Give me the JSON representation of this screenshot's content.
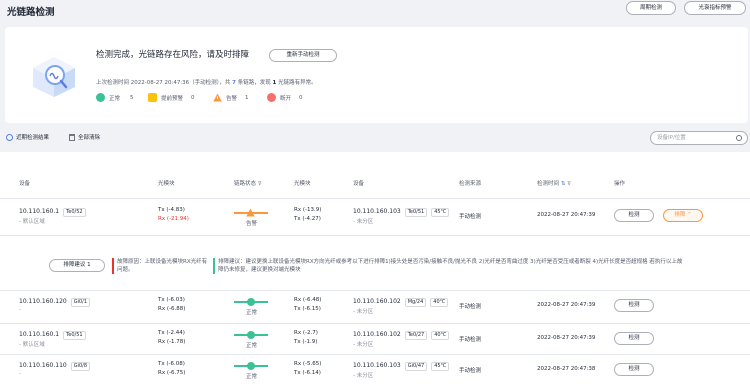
{
  "header": {
    "title": "光链路检测",
    "periodic_btn": "周期检测",
    "alarm_btn": "光衰指标预警"
  },
  "summary": {
    "headline": "检测完成，光链路存在风险，请及时排障",
    "rerun_btn": "重新手动检测",
    "last_time_prefix": "上次检测时间 ",
    "last_time": "2022-08-27 20:47:36（手动检测）",
    "total_prefix": "，共 ",
    "total": "7",
    "total_suffix": " 条链路，发现 ",
    "abnormal": "1",
    "abnormal_suffix": " 光链路有异常。",
    "stats": [
      {
        "label": "正常",
        "value": "5",
        "color": "#3ac295"
      },
      {
        "label": "提前预警",
        "value": "0",
        "color": "#fac20a"
      },
      {
        "label": "告警",
        "value": "1",
        "color": "#fa9841"
      },
      {
        "label": "断开",
        "value": "0",
        "color": "#f66f6a"
      }
    ]
  },
  "toolbar": {
    "history": "近期检测结果",
    "clear": "全部清除",
    "search_placeholder": "设备IP/位置"
  },
  "table": {
    "columns": [
      "设备",
      "光模块",
      "链路状态",
      "光模块",
      "设备",
      "检测来源",
      "检测时间",
      "操作"
    ],
    "rows": [
      {
        "ip": "10.110.160.1",
        "port": "Te0/52",
        "area": "- 默认区域",
        "tx": "Tx (-4.83)",
        "rx": "Rx (-21.94)",
        "rx_alert": true,
        "status": "告警",
        "status_color": "#fa9841",
        "peer_tx": "Rx (-13.9)",
        "peer_rx": "Tx (-4.27)",
        "peer_ip": "10.110.160.103",
        "peer_port": "Te0/51",
        "temp": "45℃",
        "peer_area": "- 未分区",
        "source": "手动检测",
        "time": "2022-08-27 20:47:39",
        "action": "检测",
        "fault": "排障"
      },
      {
        "ip": "10.110.160.120",
        "port": "Gi0/1",
        "area": "-",
        "tx": "Tx (-6.03)",
        "rx": "Rx (-6.88)",
        "rx_alert": false,
        "status": "正常",
        "status_color": "#3ac295",
        "peer_tx": "Rx (-6.48)",
        "peer_rx": "Tx (-6.15)",
        "peer_ip": "10.110.160.102",
        "peer_port": "Mg/24",
        "temp": "40℃",
        "peer_area": "- 未分区",
        "source": "手动检测",
        "time": "2022-08-27 20:47:39",
        "action": "检测"
      },
      {
        "ip": "10.110.160.1",
        "port": "Te0/51",
        "area": "- 默认区域",
        "tx": "Tx (-2.44)",
        "rx": "Rx (-1.78)",
        "rx_alert": false,
        "status": "正常",
        "status_color": "#3ac295",
        "peer_tx": "Rx (-2.7)",
        "peer_rx": "Tx (-1.9)",
        "peer_ip": "10.110.160.102",
        "peer_port": "Te0/27",
        "temp": "40℃",
        "peer_area": "- 未分区",
        "source": "手动检测",
        "time": "2022-08-27 20:47:39",
        "action": "检测"
      },
      {
        "ip": "10.110.160.110",
        "port": "Gi0/8",
        "area": "-",
        "tx": "Tx (-6.08)",
        "rx": "Rx (-6.75)",
        "rx_alert": false,
        "status": "正常",
        "status_color": "#3ac295",
        "peer_tx": "Rx (-5.65)",
        "peer_rx": "Tx (-6.14)",
        "peer_ip": "10.110.160.103",
        "peer_port": "Gi0/47",
        "temp": "45℃",
        "peer_area": "- 未分区",
        "source": "手动检测",
        "time": "2022-08-27 20:47:38",
        "action": "检测"
      }
    ],
    "expand": {
      "sugg_btn": "排障建议 1",
      "reason": "故障原因：上联设备光模块RX光纤有问题。",
      "advice": "排障建议：建议更换上联设备光模块RX方向光纤或参考以下进行排障1)接头处是否污染/接触不良/抛光不良 2)光纤是否弯曲过度 3)光纤是否受压或者断裂 4)光纤长度是否超规格 若执行以上故障仍未修复，建议更换对端光模块"
    }
  }
}
